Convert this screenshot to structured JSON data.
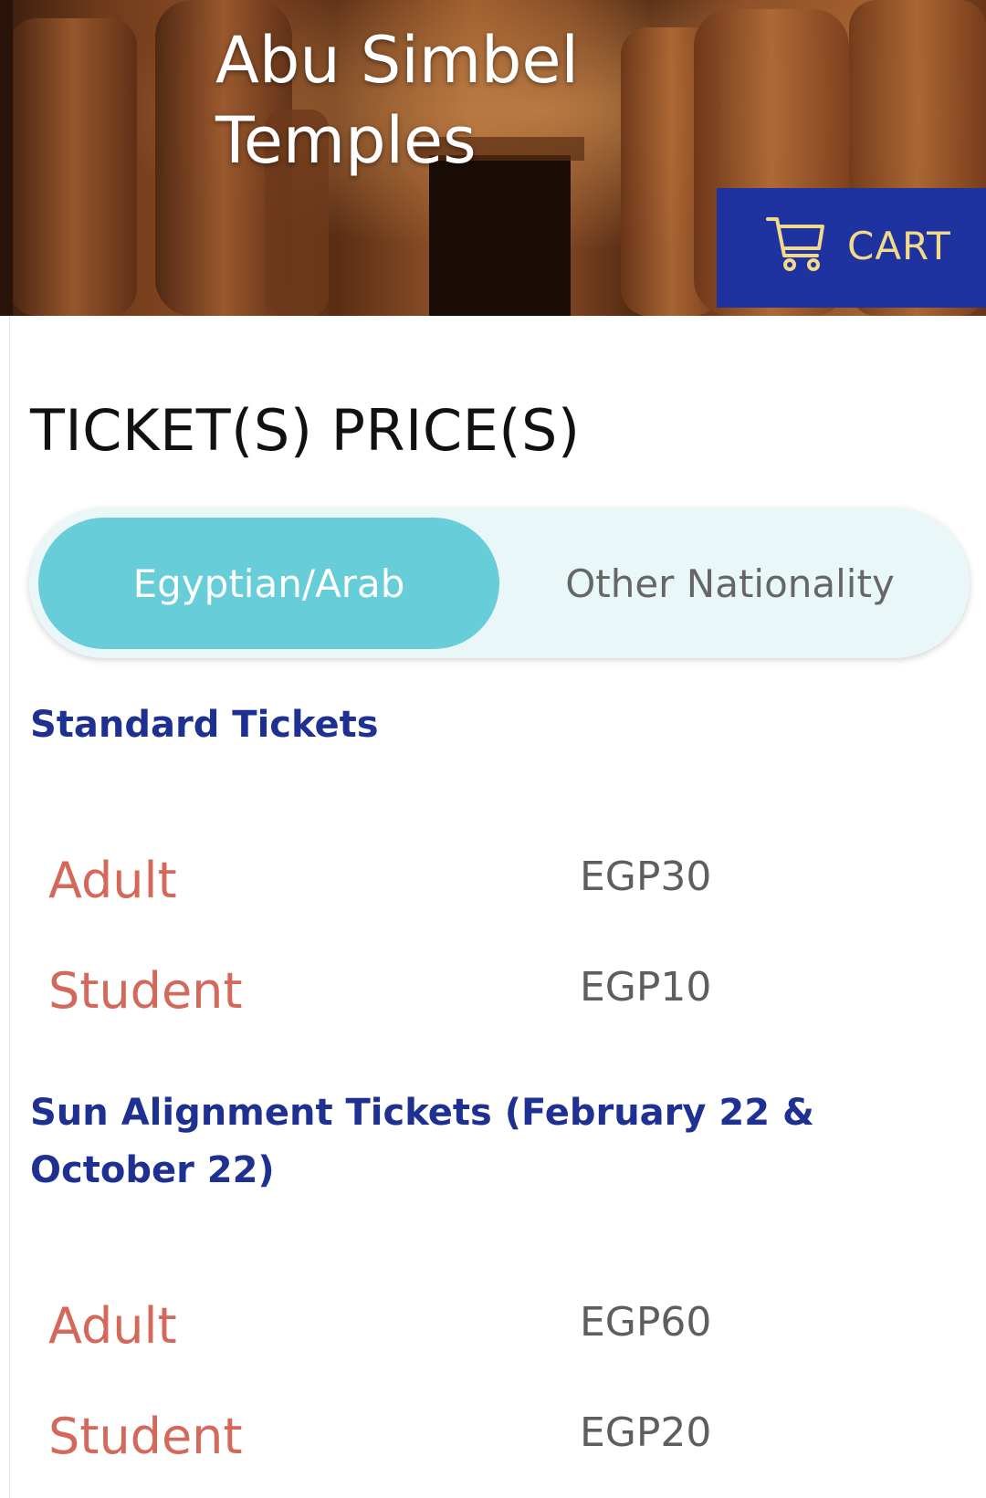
{
  "hero": {
    "title_line1": "Abu Simbel",
    "title_line2": "Temples",
    "cart": {
      "label": "CART",
      "icon": "shopping-cart-icon",
      "color": "#1e33a0",
      "label_color": "#f3d98a"
    }
  },
  "prices": {
    "heading": "TICKET(S) PRICE(S)",
    "toggle": {
      "options": [
        {
          "label": "Egyptian/Arab",
          "selected": true
        },
        {
          "label": "Other Nationality",
          "selected": false
        }
      ],
      "active_color": "#66cdd9"
    },
    "groups": [
      {
        "title": "Standard Tickets",
        "rows": [
          {
            "label": "Adult",
            "price": "EGP30"
          },
          {
            "label": "Student",
            "price": "EGP10"
          }
        ]
      },
      {
        "title": "Sun Alignment Tickets (February 22 & October 22)",
        "rows": [
          {
            "label": "Adult",
            "price": "EGP60"
          },
          {
            "label": "Student",
            "price": "EGP20"
          }
        ]
      }
    ]
  },
  "colors": {
    "group_title": "#1e3192",
    "row_label": "#d4685a",
    "row_price": "#5e5e5e"
  }
}
